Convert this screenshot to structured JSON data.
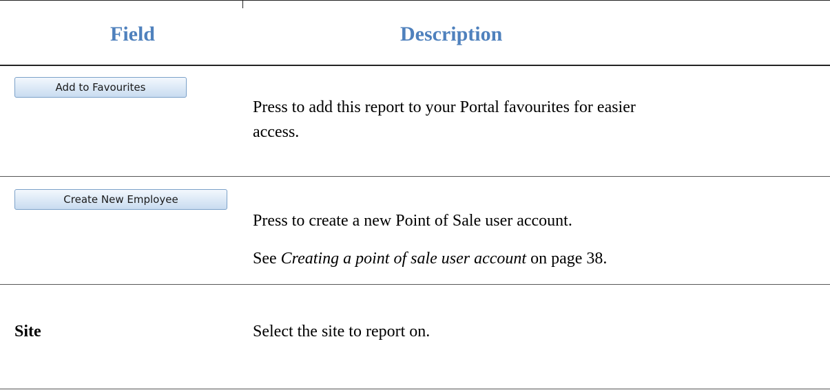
{
  "header": {
    "field": "Field",
    "description": "Description"
  },
  "rows": [
    {
      "button_label": "Add to Favourites",
      "description_lines": [
        "Press to add this report to your Portal favourites for easier",
        "access."
      ]
    },
    {
      "button_label": "Create New Employee",
      "description": "Press to create a new Point of Sale user account.",
      "see_prefix": "See ",
      "see_ref": "Creating a point of sale user account",
      "see_suffix": " on page 38."
    },
    {
      "field": "Site",
      "description": "Select the site to report on."
    }
  ],
  "colors": {
    "header_text": "#4f81bd",
    "button_border": "#7aa0c8",
    "button_fill": "#dbe8f6"
  }
}
